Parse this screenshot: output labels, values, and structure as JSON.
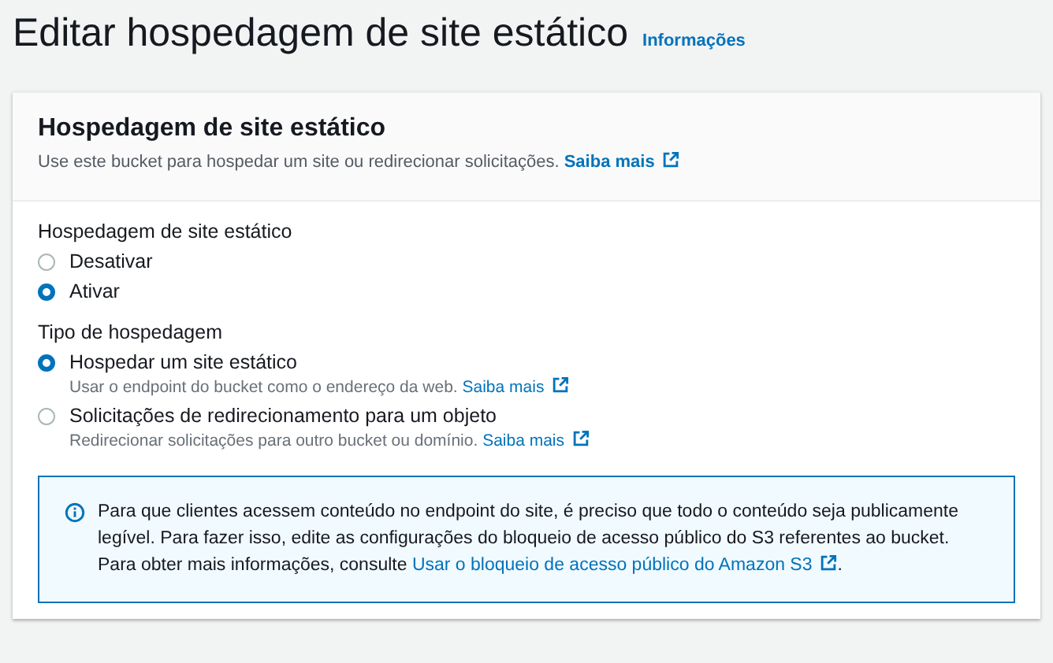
{
  "page": {
    "title": "Editar hospedagem de site estático",
    "info_link": "Informações"
  },
  "panel": {
    "title": "Hospedagem de site estático",
    "description": "Use este bucket para hospedar um site ou redirecionar solicitações.",
    "learn_more": "Saiba mais"
  },
  "groups": [
    {
      "label": "Hospedagem de site estático",
      "options": [
        {
          "label": "Desativar",
          "selected": false
        },
        {
          "label": "Ativar",
          "selected": true
        }
      ]
    },
    {
      "label": "Tipo de hospedagem",
      "options": [
        {
          "label": "Hospedar um site estático",
          "description": "Usar o endpoint do bucket como o endereço da web.",
          "learn_more": "Saiba mais",
          "selected": true
        },
        {
          "label": "Solicitações de redirecionamento para um objeto",
          "description": "Redirecionar solicitações para outro bucket ou domínio.",
          "learn_more": "Saiba mais",
          "selected": false
        }
      ]
    }
  ],
  "alert": {
    "text": "Para que clientes acessem conteúdo no endpoint do site, é preciso que todo o conteúdo seja publicamente legível. Para fazer isso, edite as configurações do bloqueio de acesso público do S3 referentes ao bucket. Para obter mais informações, consulte",
    "link": "Usar o bloqueio de acesso público do Amazon S3",
    "text_after": "."
  }
}
